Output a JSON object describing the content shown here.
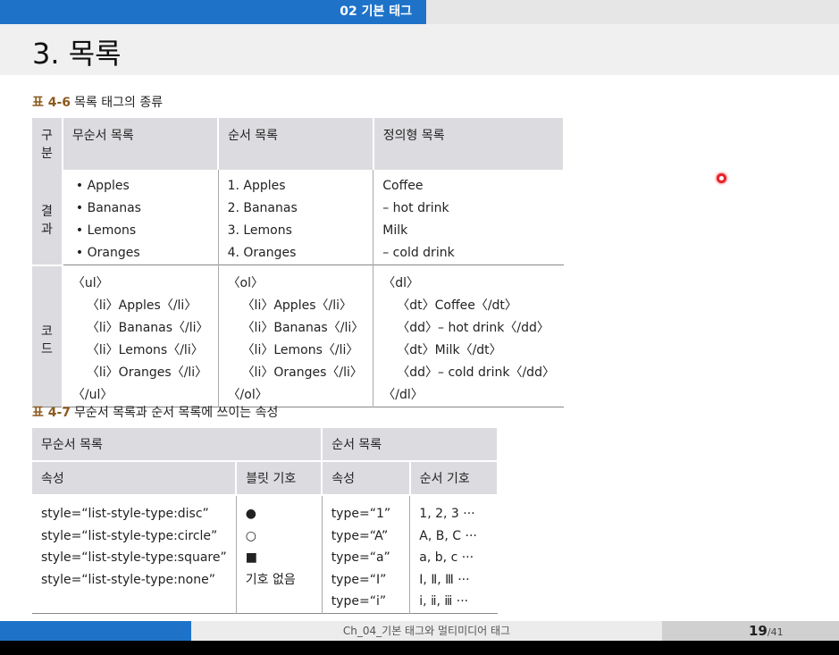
{
  "header": {
    "chapter": "02 기본 태그"
  },
  "title": "3. 목록",
  "table1": {
    "number": "표 4-6",
    "caption": "목록 태그의 종류",
    "headers": [
      "구분",
      "무순서 목록",
      "순서 목록",
      "정의형 목록"
    ],
    "result_label": "결과",
    "code_label": "코드",
    "result": {
      "unordered": [
        "• Apples",
        "• Bananas",
        "• Lemons",
        "• Oranges"
      ],
      "ordered": [
        "1. Apples",
        "2. Bananas",
        "3. Lemons",
        "4. Oranges"
      ],
      "definition": [
        "Coffee",
        "– hot drink",
        "Milk",
        "– cold drink"
      ]
    },
    "code": {
      "unordered": [
        "〈ul〉",
        "〈li〉Apples〈/li〉",
        "〈li〉Bananas〈/li〉",
        "〈li〉Lemons〈/li〉",
        "〈li〉Oranges〈/li〉",
        "〈/ul〉"
      ],
      "ordered": [
        "〈ol〉",
        "〈li〉Apples〈/li〉",
        "〈li〉Bananas〈/li〉",
        "〈li〉Lemons〈/li〉",
        "〈li〉Oranges〈/li〉",
        "〈/ol〉"
      ],
      "definition": [
        "〈dl〉",
        "〈dt〉Coffee〈/dt〉",
        "〈dd〉– hot drink〈/dd〉",
        "〈dt〉Milk〈/dt〉",
        "〈dd〉– cold drink〈/dd〉",
        "〈/dl〉"
      ]
    }
  },
  "table2": {
    "number": "표 4-7",
    "caption": "무순서 목록과 순서 목록에 쓰이는 속성",
    "group_unordered": "무순서 목록",
    "group_ordered": "순서 목록",
    "headers": [
      "속성",
      "블릿 기호",
      "속성",
      "순서 기호"
    ],
    "unordered_attrs": [
      "style=“list-style-type:disc”",
      "style=“list-style-type:circle”",
      "style=“list-style-type:square”",
      "style=“list-style-type:none”"
    ],
    "bullets": [
      "●",
      "○",
      "■",
      "기호 없음"
    ],
    "ordered_attrs": [
      "type=“1”",
      "type=“A”",
      "type=“a”",
      "type=“I”",
      "type=“i”"
    ],
    "order_symbols": [
      "1, 2, 3 ···",
      "A, B, C ···",
      "a, b, c ···",
      "Ⅰ, Ⅱ, Ⅲ ···",
      "ⅰ, ⅱ, ⅲ ···"
    ]
  },
  "footer": {
    "doc_title": "Ch_04_기본 태그와 멀티미디어 태그",
    "page": "19",
    "total": "/41"
  },
  "colors": {
    "accent": "#1e73c9",
    "caption_number": "#8b5a1e",
    "header_fill": "#dcdce0",
    "pointer": "#e8232a"
  }
}
